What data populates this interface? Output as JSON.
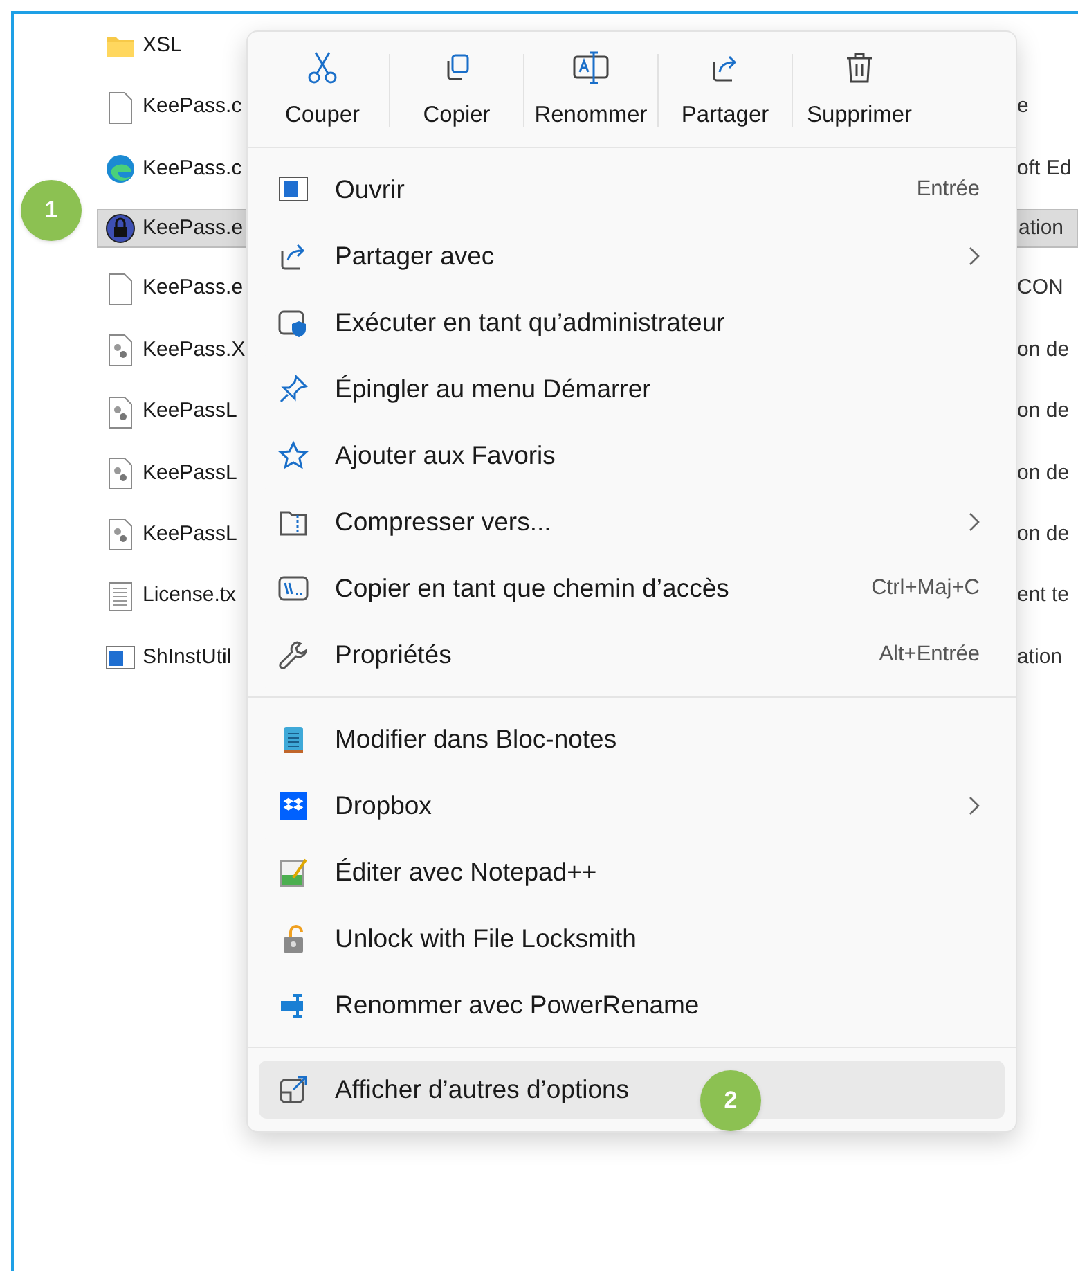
{
  "files": [
    {
      "name": "XSL",
      "kind": "folder",
      "selected": false
    },
    {
      "name": "KeePass.c",
      "kind": "document",
      "selected": false,
      "type": "e"
    },
    {
      "name": "KeePass.c",
      "kind": "browser",
      "selected": false,
      "type": "oft Ed"
    },
    {
      "name": "KeePass.e",
      "kind": "app",
      "selected": true,
      "type": "ation"
    },
    {
      "name": "KeePass.e",
      "kind": "document",
      "selected": false,
      "type": "CON"
    },
    {
      "name": "KeePass.X",
      "kind": "config",
      "selected": false,
      "type": "on de"
    },
    {
      "name": "KeePassL",
      "kind": "config",
      "selected": false,
      "type": "on de"
    },
    {
      "name": "KeePassL",
      "kind": "config",
      "selected": false,
      "type": "on de"
    },
    {
      "name": "KeePassL",
      "kind": "config",
      "selected": false,
      "type": "on de"
    },
    {
      "name": "License.tx",
      "kind": "text",
      "selected": false,
      "type": "ent te"
    },
    {
      "name": "ShInstUtil",
      "kind": "window",
      "selected": false,
      "type": "ation"
    }
  ],
  "context_menu": {
    "toolbar": [
      {
        "label": "Couper"
      },
      {
        "label": "Copier"
      },
      {
        "label": "Renommer"
      },
      {
        "label": "Partager"
      },
      {
        "label": "Supprimer"
      }
    ],
    "groups": [
      [
        {
          "label": "Ouvrir",
          "shortcut": "Entrée",
          "submenu": false,
          "selected": false
        },
        {
          "label": "Partager avec",
          "submenu": true,
          "selected": false
        },
        {
          "label": "Exécuter en tant qu’administrateur",
          "submenu": false,
          "selected": false
        },
        {
          "label": "Épingler au menu Démarrer",
          "submenu": false,
          "selected": false
        },
        {
          "label": "Ajouter aux Favoris",
          "submenu": false,
          "selected": false
        },
        {
          "label": "Compresser vers...",
          "submenu": true,
          "selected": false
        },
        {
          "label": "Copier en tant que chemin d’accès",
          "shortcut": "Ctrl+Maj+C",
          "submenu": false,
          "selected": false
        },
        {
          "label": "Propriétés",
          "shortcut": "Alt+Entrée",
          "submenu": false,
          "selected": false
        }
      ],
      [
        {
          "label": "Modifier dans Bloc-notes",
          "submenu": false,
          "selected": false
        },
        {
          "label": "Dropbox",
          "submenu": true,
          "selected": false
        },
        {
          "label": "Éditer avec Notepad++",
          "submenu": false,
          "selected": false
        },
        {
          "label": "Unlock with File Locksmith",
          "submenu": false,
          "selected": false
        },
        {
          "label": "Renommer avec PowerRename",
          "submenu": false,
          "selected": false
        }
      ],
      [
        {
          "label": "Afficher d’autres d’options",
          "submenu": false,
          "selected": true
        }
      ]
    ]
  },
  "callouts": [
    {
      "label": "1"
    },
    {
      "label": "2"
    }
  ]
}
